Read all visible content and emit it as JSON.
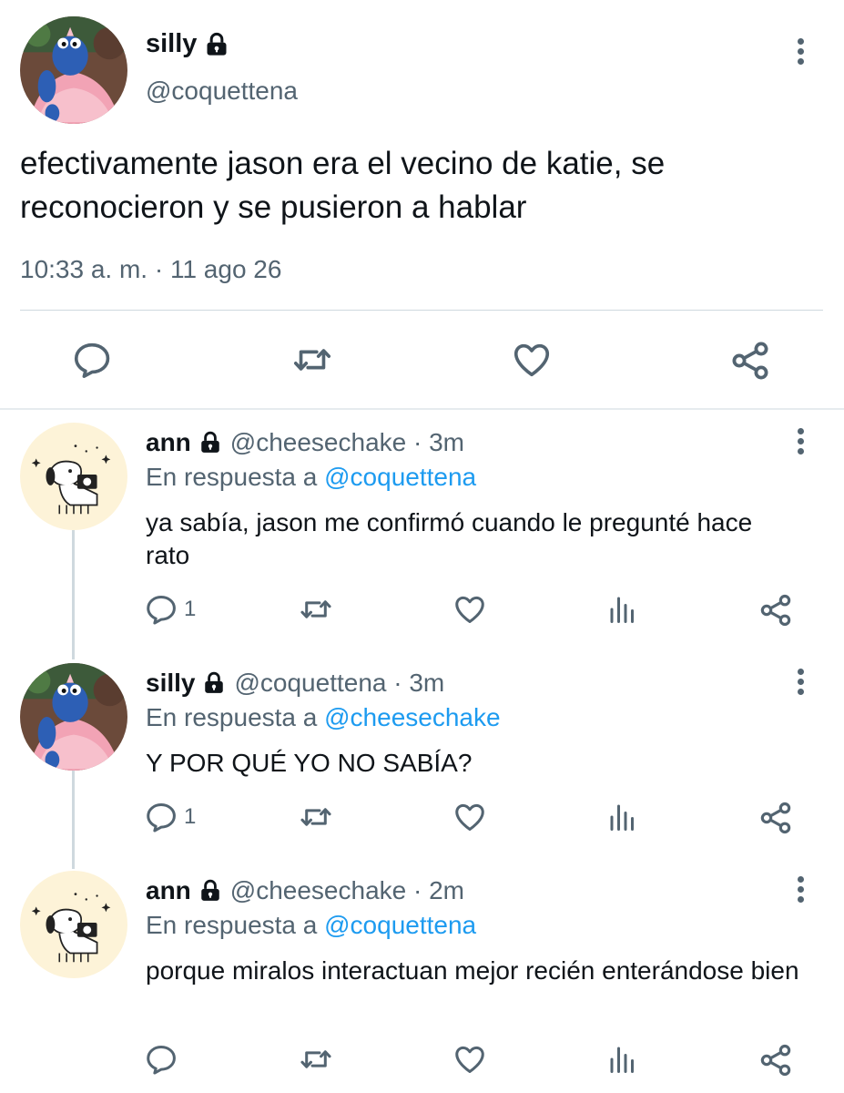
{
  "main_tweet": {
    "display_name": "silly",
    "handle": "@coquettena",
    "avatar_caption": "Coquette",
    "text": "efectivamente jason era el vecino de katie, se reconocieron y se pusieron a hablar",
    "timestamp": "10:33 a. m. · 11 ago 26",
    "icons": [
      "reply-icon",
      "retweet-icon",
      "like-icon",
      "share-icon"
    ]
  },
  "replies": [
    {
      "display_name": "ann",
      "handle_time": "@cheesechake · 3m",
      "reply_prefix": "En respuesta a",
      "reply_mention": "@coquettena",
      "text": "ya sabía, jason me confirmó cuando le pregunté hace rato",
      "reply_count": "1"
    },
    {
      "display_name": "silly",
      "handle_time": "@coquettena · 3m",
      "reply_prefix": "En respuesta a",
      "reply_mention": "@cheesechake",
      "text": "Y POR QUÉ YO NO SABÍA?",
      "reply_count": "1",
      "avatar_caption": "Coquette"
    },
    {
      "display_name": "ann",
      "handle_time": "@cheesechake · 2m",
      "reply_prefix": "En respuesta a",
      "reply_mention": "@coquettena",
      "text": "porque miralos interactuan mejor recién enterándose bien",
      "reply_count": ""
    }
  ],
  "colors": {
    "text": "#0f1419",
    "secondary": "#536471",
    "link": "#1d9bf0",
    "divider": "#cfd9de"
  }
}
